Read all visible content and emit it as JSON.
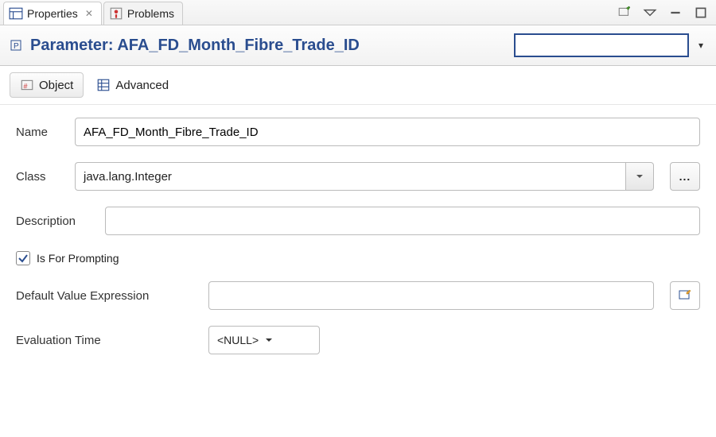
{
  "tabs": {
    "properties": "Properties",
    "problems": "Problems"
  },
  "header": {
    "title": "Parameter: AFA_FD_Month_Fibre_Trade_ID",
    "search_value": ""
  },
  "subtabs": {
    "object": "Object",
    "advanced": "Advanced"
  },
  "form": {
    "name_label": "Name",
    "name_value": "AFA_FD_Month_Fibre_Trade_ID",
    "class_label": "Class",
    "class_value": "java.lang.Integer",
    "ellipsis": "...",
    "description_label": "Description",
    "description_value": "",
    "prompting_label": "Is For Prompting",
    "default_expr_label": "Default Value Expression",
    "default_expr_value": "",
    "eval_time_label": "Evaluation Time",
    "eval_time_value": "<NULL>"
  }
}
